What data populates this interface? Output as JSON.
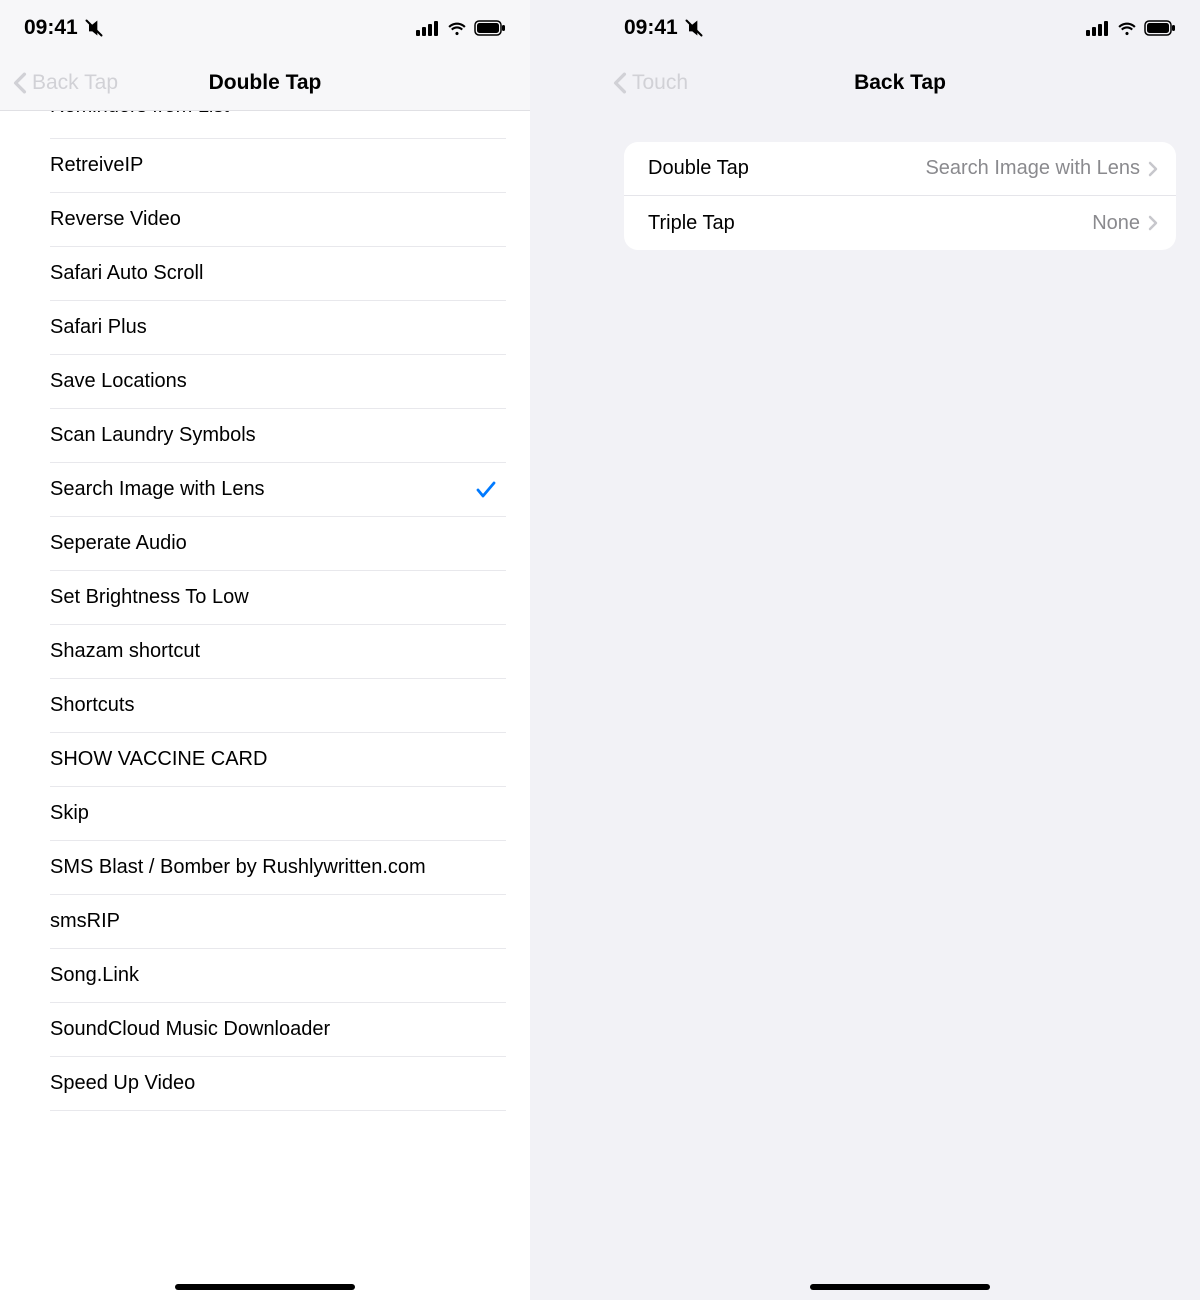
{
  "status": {
    "time": "09:41"
  },
  "left": {
    "back_label": "Back Tap",
    "title": "Double Tap",
    "items": [
      {
        "label": "Reminders from List",
        "selected": false,
        "clipped": true
      },
      {
        "label": "RetreiveIP",
        "selected": false
      },
      {
        "label": "Reverse Video",
        "selected": false
      },
      {
        "label": "Safari Auto Scroll",
        "selected": false
      },
      {
        "label": "Safari Plus",
        "selected": false
      },
      {
        "label": "Save Locations",
        "selected": false
      },
      {
        "label": "Scan Laundry Symbols",
        "selected": false
      },
      {
        "label": "Search Image with Lens",
        "selected": true
      },
      {
        "label": "Seperate Audio",
        "selected": false
      },
      {
        "label": "Set Brightness To Low",
        "selected": false
      },
      {
        "label": "Shazam shortcut",
        "selected": false
      },
      {
        "label": "Shortcuts",
        "selected": false
      },
      {
        "label": "SHOW VACCINE CARD",
        "selected": false
      },
      {
        "label": "Skip",
        "selected": false
      },
      {
        "label": "SMS Blast / Bomber by Rushlywritten.com",
        "selected": false
      },
      {
        "label": "smsRIP",
        "selected": false
      },
      {
        "label": "Song.Link",
        "selected": false
      },
      {
        "label": "SoundCloud Music Downloader",
        "selected": false
      },
      {
        "label": "Speed Up Video",
        "selected": false
      }
    ]
  },
  "right": {
    "back_label": "Touch",
    "title": "Back Tap",
    "rows": [
      {
        "label": "Double Tap",
        "value": "Search Image with Lens"
      },
      {
        "label": "Triple Tap",
        "value": "None"
      }
    ]
  }
}
